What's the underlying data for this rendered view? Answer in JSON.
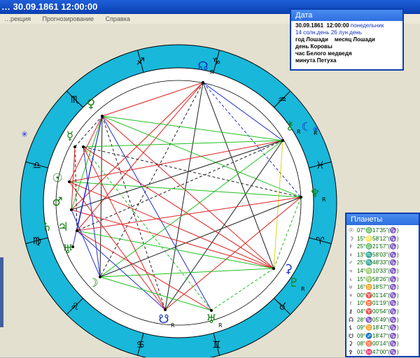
{
  "window": {
    "title": "… 30.09.1861  12:00:00"
  },
  "menu": {
    "items": [
      "…рекция",
      "Прогнозирование",
      "Справка"
    ]
  },
  "date_panel": {
    "title": "Дата",
    "date": "30.09.1861",
    "time": "12:00:00",
    "weekday": "понедельник",
    "solar_day": "14 солн.день",
    "lunar_day": "26 лун.день",
    "year": "год Лошади",
    "month": "месяц Лошади",
    "day": "день Коровы",
    "hour": "час Белого медведя",
    "minute": "минута Петуха"
  },
  "planets_panel": {
    "title": "Планеты",
    "rows": [
      {
        "icon": "sun-icon",
        "glyph": "☉",
        "text": "07°♎17'35\"(♑)"
      },
      {
        "icon": "moon-icon",
        "glyph": "☽",
        "text": "15°♌58'12\"(♑)"
      },
      {
        "icon": "mercury-icon",
        "glyph": "☿",
        "text": "25°♎21'57\"(♑)"
      },
      {
        "icon": "venus-icon",
        "glyph": "♀",
        "text": "13°♏58'03\"(♑)"
      },
      {
        "icon": "mars-icon",
        "glyph": "♂",
        "text": "25°♏48'33\"(♑)"
      },
      {
        "icon": "jupiter-icon",
        "glyph": "♃",
        "text": "14°♍10'33\"(♑)"
      },
      {
        "icon": "saturn-icon",
        "glyph": "♄",
        "text": "15°♍58'26\"(♑)"
      },
      {
        "icon": "uranus-icon",
        "glyph": "♅",
        "text": "16°♊18'57\"(♑)"
      },
      {
        "icon": "neptune-icon",
        "glyph": "♆",
        "text": "00°♈01'14\"(♑)"
      },
      {
        "icon": "pluto-icon",
        "glyph": "♇",
        "text": "10°♉01'19\"(♑)"
      },
      {
        "icon": "chiron-icon",
        "glyph": "⚷",
        "text": "04°♈00'54\"(♑)"
      },
      {
        "icon": "north-node-icon",
        "glyph": "☊",
        "text": "28°♑05'49\"(♑)"
      },
      {
        "icon": "lilith-icon",
        "glyph": "⚸",
        "text": "09°♊18'47\"(♑)"
      },
      {
        "icon": "selena-icon",
        "glyph": "☋",
        "text": "09°♐18'47\"(♑)"
      },
      {
        "icon": "ceres-icon",
        "glyph": "⚳",
        "text": "08°♉00'14\"(♑)"
      },
      {
        "icon": "extra-icon",
        "glyph": "⚴",
        "text": "01°♓47'00\"(♑)"
      }
    ]
  },
  "chart": {
    "zodiac_glyphs": [
      "♐",
      "♑",
      "♒",
      "♓",
      "♈",
      "♉",
      "♊",
      "♋",
      "♌",
      "♍",
      "♎",
      "♏"
    ],
    "planet_glyphs": [
      {
        "name": "north-node",
        "glyph": "☊",
        "retro": "R",
        "color": "#1030c0"
      },
      {
        "name": "chiron",
        "glyph": "⚷",
        "retro": "R",
        "color": "#108010"
      },
      {
        "name": "lilith",
        "glyph": "☾",
        "retro": "R",
        "color": "#1030c0"
      },
      {
        "name": "neptune",
        "glyph": "♆",
        "retro": "R",
        "color": "#108010"
      },
      {
        "name": "pluto",
        "glyph": "♇",
        "retro": "R",
        "color": "#108010"
      },
      {
        "name": "ceres",
        "glyph": "⚳",
        "retro": "",
        "color": "#1030c0"
      },
      {
        "name": "uranus",
        "glyph": "♅",
        "retro": "R",
        "color": "#108010"
      },
      {
        "name": "south-node",
        "glyph": "☋",
        "retro": "R",
        "color": "#1030c0"
      },
      {
        "name": "moon",
        "glyph": "☽",
        "retro": "",
        "color": "#108010"
      },
      {
        "name": "jupiter",
        "glyph": "♃",
        "retro": "",
        "color": "#108010"
      },
      {
        "name": "uranus2",
        "glyph": "♅",
        "retro": "",
        "color": "#108010"
      },
      {
        "name": "saturn",
        "glyph": "♄",
        "retro": "",
        "color": "#108010"
      },
      {
        "name": "mars",
        "glyph": "♂",
        "retro": "",
        "color": "#108010"
      },
      {
        "name": "sun",
        "glyph": "☉",
        "retro": "",
        "color": "#108010"
      },
      {
        "name": "mercury",
        "glyph": "☿",
        "retro": "",
        "color": "#108010"
      },
      {
        "name": "venus",
        "glyph": "♀",
        "retro": "",
        "color": "#108010"
      }
    ],
    "colors": {
      "ring": "#19b7d9",
      "red": "#e02020",
      "green": "#20c020",
      "blue": "#2030d0",
      "black": "#202020",
      "yellow": "#e0d020"
    }
  }
}
